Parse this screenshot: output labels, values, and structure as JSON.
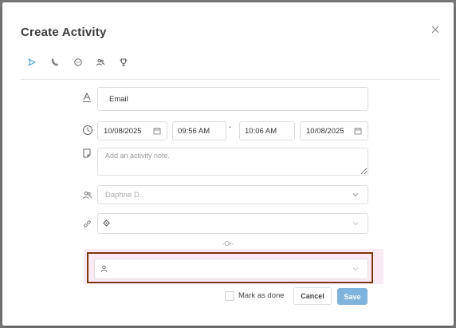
{
  "dialog": {
    "title": "Create Activity"
  },
  "tabs": [
    {
      "icon": "send-icon"
    },
    {
      "icon": "phone-icon"
    },
    {
      "icon": "chat-bubble-icon"
    },
    {
      "icon": "people-icon"
    },
    {
      "icon": "trophy-icon"
    }
  ],
  "form": {
    "title_value": "Email",
    "start_date": "10/08/2025",
    "start_time": "09:56 AM",
    "time_separator": "-",
    "end_time": "10:06 AM",
    "end_date": "10/08/2025",
    "note_placeholder": "Add an activity note.",
    "assignee": "Daphne D.",
    "or_label": "-Or-",
    "mark_done_label": "Mark as done"
  },
  "buttons": {
    "cancel": "Cancel",
    "save": "Save"
  },
  "colors": {
    "accent": "#4a9fd8",
    "save_bg": "#7fb3dc",
    "highlight_border": "#7b3a0c",
    "highlight_bg": "#fbe9f3"
  }
}
